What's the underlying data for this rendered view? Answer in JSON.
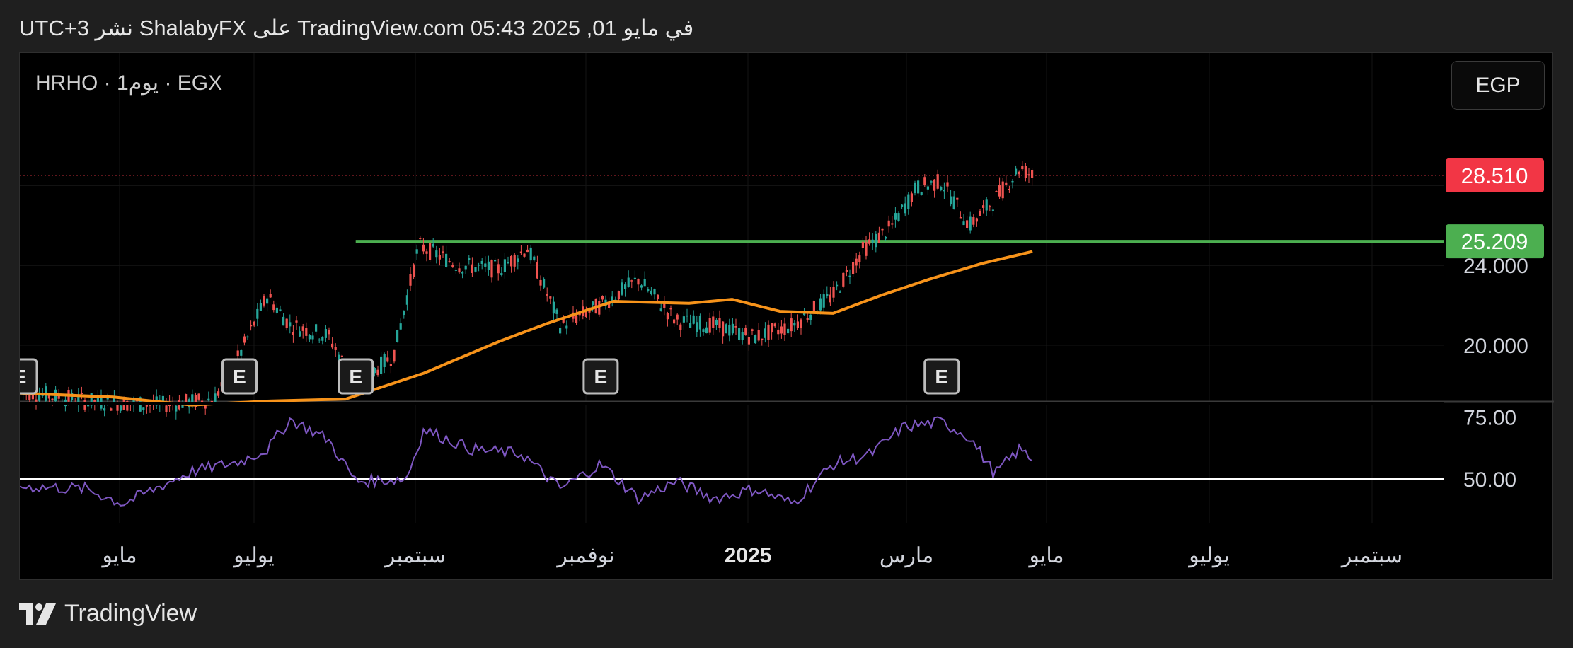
{
  "header": {
    "text": "UTC+3 نشر ShalabyFX على TradingView.com في مايو 01, 2025 05:43"
  },
  "symbol": {
    "label": "HRHO · 1يوم · EGX"
  },
  "currency": {
    "label": "EGP"
  },
  "footer": {
    "brand": "TradingView"
  },
  "chart_data": [
    {
      "type": "line",
      "panel": "price",
      "price_axis_ticks": [
        "20.000",
        "24.000"
      ],
      "last_price": {
        "label": "28.510",
        "value": 28.51,
        "color": "#f23645"
      },
      "horizontal_line": {
        "label": "25.209",
        "value": 25.209,
        "color": "#4caf50"
      },
      "earnings_marker": "E",
      "earnings_markers_at": [
        "2024-03-25",
        "2024-06-20",
        "2024-08-05",
        "2024-11-10",
        "2025-03-25"
      ],
      "moving_average": {
        "color": "#f7931a",
        "x": [
          "2024-03-25",
          "2024-05-01",
          "2024-06-01",
          "2024-07-01",
          "2024-08-01",
          "2024-09-01",
          "2024-10-01",
          "2024-10-20",
          "2024-11-15",
          "2024-12-15",
          "2025-01-01",
          "2025-01-20",
          "2025-02-10",
          "2025-03-01",
          "2025-03-20",
          "2025-04-10",
          "2025-04-30"
        ],
        "y": [
          17.6,
          17.4,
          17.0,
          17.2,
          17.3,
          18.6,
          20.2,
          21.1,
          22.2,
          22.1,
          22.3,
          21.7,
          21.6,
          22.5,
          23.3,
          24.1,
          24.7
        ]
      },
      "candles_close": {
        "x": [
          "2024-03-25",
          "2024-04-20",
          "2024-05-20",
          "2024-06-10",
          "2024-06-20",
          "2024-07-01",
          "2024-07-10",
          "2024-07-25",
          "2024-08-05",
          "2024-08-20",
          "2024-08-30",
          "2024-09-15",
          "2024-10-01",
          "2024-10-12",
          "2024-10-25",
          "2024-11-10",
          "2024-11-25",
          "2024-12-10",
          "2024-12-25",
          "2025-01-10",
          "2025-01-25",
          "2025-02-10",
          "2025-02-22",
          "2025-03-05",
          "2025-03-15",
          "2025-03-25",
          "2025-04-05",
          "2025-04-15",
          "2025-04-25",
          "2025-04-30"
        ],
        "y": [
          17.7,
          17.2,
          17.0,
          17.3,
          19.5,
          22.5,
          21.0,
          20.5,
          18.0,
          19.5,
          25.0,
          24.0,
          23.8,
          24.9,
          21.0,
          22.0,
          23.3,
          21.2,
          21.0,
          20.4,
          21.0,
          22.5,
          24.8,
          25.9,
          27.9,
          28.2,
          26.0,
          27.3,
          28.9,
          28.5
        ]
      },
      "x_axis_ticks": [
        "مايو",
        "يوليو",
        "سبتمبر",
        "نوفمبر",
        "2025",
        "مارس",
        "مايو",
        "يوليو",
        "سبتمبر"
      ]
    },
    {
      "type": "line",
      "panel": "oscillator",
      "color": "#7e57c2",
      "axis_ticks": [
        "75.00",
        "50.00"
      ],
      "reference_level": 50,
      "x": [
        "2024-03-25",
        "2024-04-20",
        "2024-05-05",
        "2024-06-01",
        "2024-06-20",
        "2024-07-01",
        "2024-07-10",
        "2024-07-25",
        "2024-08-05",
        "2024-08-25",
        "2024-09-01",
        "2024-09-20",
        "2024-10-10",
        "2024-10-25",
        "2024-11-10",
        "2024-11-25",
        "2024-12-10",
        "2024-12-25",
        "2025-01-10",
        "2025-01-25",
        "2025-02-10",
        "2025-02-25",
        "2025-03-10",
        "2025-03-25",
        "2025-04-05",
        "2025-04-15",
        "2025-04-25",
        "2025-04-30"
      ],
      "y": [
        47,
        46,
        40,
        53,
        57,
        62,
        74,
        66,
        49,
        50,
        70,
        62,
        60,
        46,
        56,
        42,
        49,
        42,
        46,
        40,
        56,
        60,
        71,
        73,
        67,
        52,
        62,
        58
      ]
    }
  ]
}
